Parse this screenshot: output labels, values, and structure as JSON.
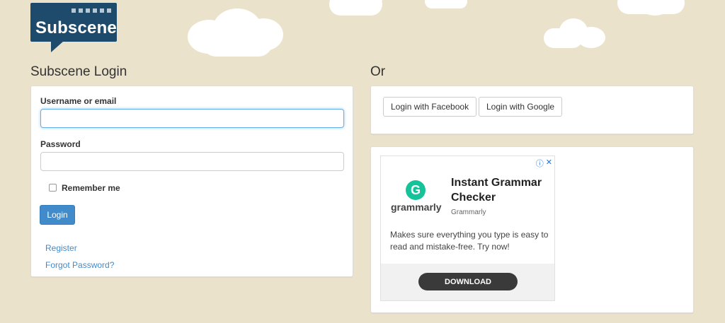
{
  "logo": {
    "text": "Subscene"
  },
  "login": {
    "title": "Subscene Login",
    "username_label": "Username or email",
    "username_value": "",
    "password_label": "Password",
    "remember_label": "Remember me",
    "login_button": "Login",
    "register_link": "Register",
    "forgot_link": "Forgot Password?"
  },
  "social": {
    "title": "Or",
    "facebook_button": "Login with Facebook",
    "google_button": "Login with Google"
  },
  "ad": {
    "brand_mark": "G",
    "brand_word": "grammarly",
    "headline": "Instant Grammar Checker",
    "advertiser": "Grammarly",
    "body": "Makes sure everything you type is easy to read and mistake-free. Try now!",
    "cta": "DOWNLOAD",
    "info_icon": "ⓘ",
    "close_icon": "✕"
  },
  "colors": {
    "background": "#ebe2cb",
    "logo": "#1e4a6b",
    "primary": "#428bca",
    "grammarly": "#15c39a"
  }
}
